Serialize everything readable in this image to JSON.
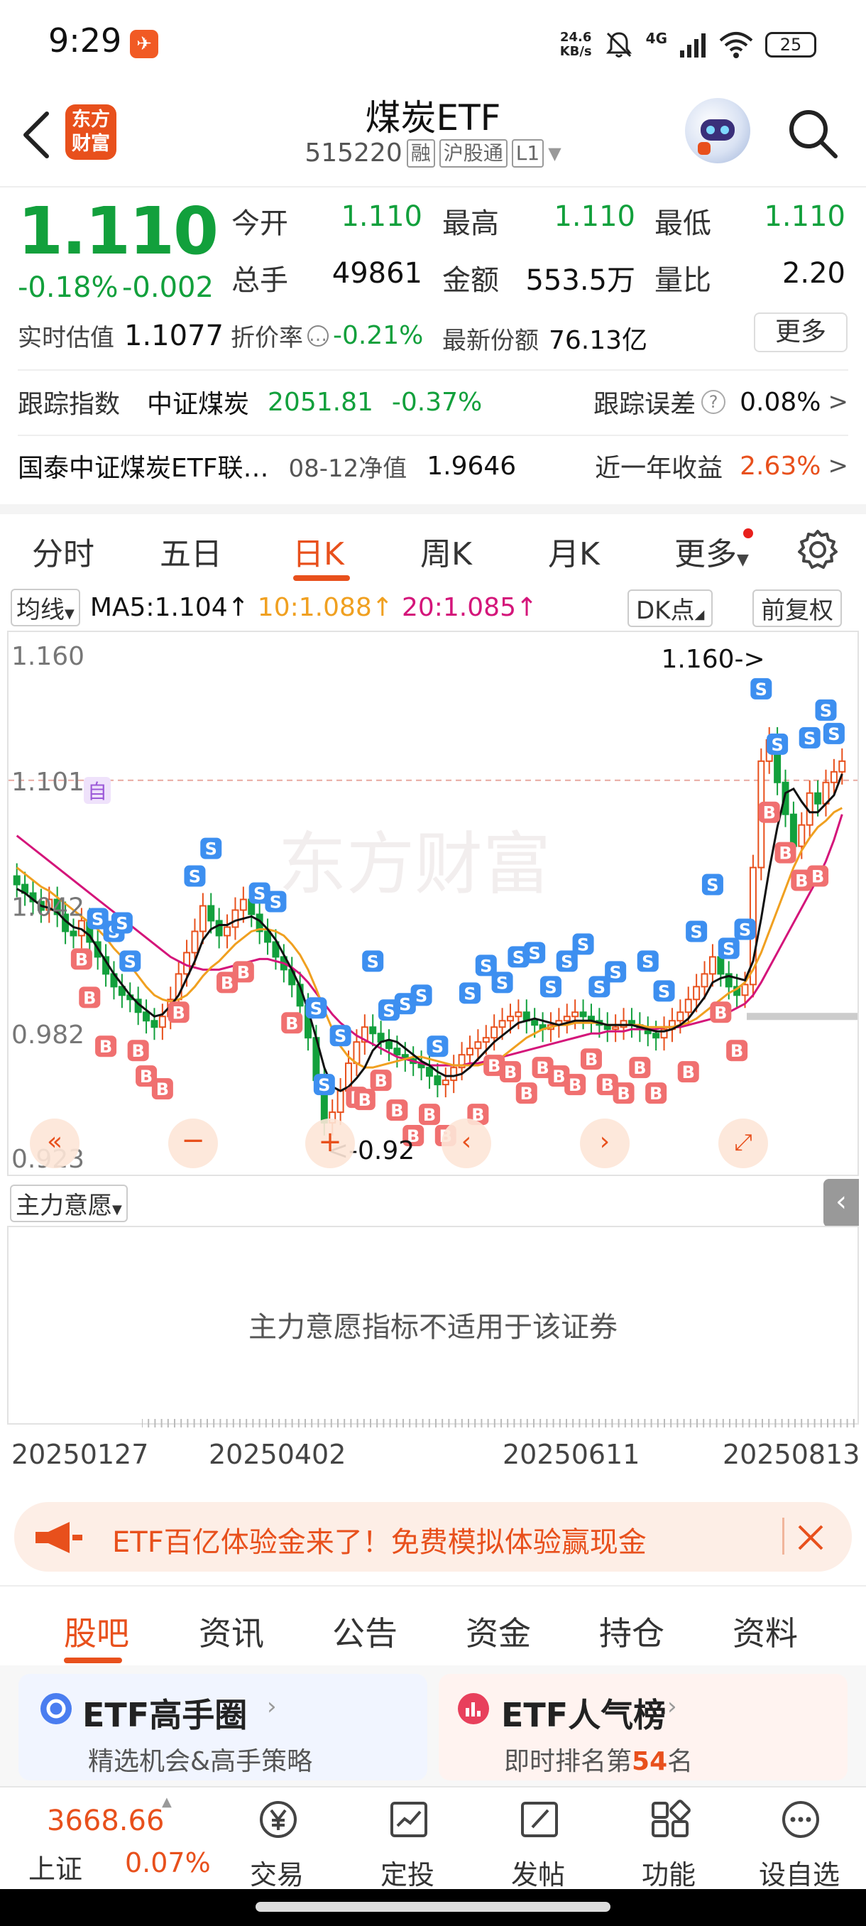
{
  "status_bar": {
    "time": "9:29",
    "net_speed_value": "24.6",
    "net_speed_unit": "KB/s",
    "network": "4G",
    "battery": "25"
  },
  "header": {
    "logo_line1": "东方",
    "logo_line2": "财富",
    "title": "煤炭ETF",
    "code": "515220",
    "tags": [
      "融",
      "沪股通",
      "L1"
    ]
  },
  "quote": {
    "price": "1.110",
    "change_pct": "-0.18%",
    "change_abs": "-0.002",
    "fields": [
      {
        "label": "今开",
        "value": "1.110",
        "green": true
      },
      {
        "label": "最高",
        "value": "1.110",
        "green": true
      },
      {
        "label": "最低",
        "value": "1.110",
        "green": true
      },
      {
        "label": "总手",
        "value": "49861",
        "green": false
      },
      {
        "label": "金额",
        "value": "553.5万",
        "green": false
      },
      {
        "label": "量比",
        "value": "2.20",
        "green": false
      }
    ],
    "rt_label": "实时估值",
    "rt_value": "1.1077",
    "discount_label": "折价率",
    "discount_value": "-0.21%",
    "shares_label": "最新份额",
    "shares_value": "76.13亿",
    "more_label": "更多",
    "track_label": "跟踪指数",
    "track_index": "中证煤炭",
    "track_value": "2051.81",
    "track_pct": "-0.37%",
    "track_err_label": "跟踪误差",
    "track_err_value": "0.08%",
    "fund_name": "国泰中证煤炭ETF联…",
    "nav_label": "08-12净值",
    "nav_value": "1.9646",
    "yearly_label": "近一年收益",
    "yearly_value": "2.63%"
  },
  "kline_tabs": [
    "分时",
    "五日",
    "日K",
    "周K",
    "月K",
    "更多"
  ],
  "kline_active": "日K",
  "ma_row": {
    "type_select": "均线",
    "ma5": "MA5:1.104",
    "ma10": "10:1.088",
    "ma20": "20:1.085",
    "dk_button": "DK点",
    "adjust_button": "前复权"
  },
  "chart_data": {
    "type": "candlestick",
    "y_ticks": [
      "1.160",
      "1.101",
      "1.042",
      "0.982",
      "0.923"
    ],
    "ylim": [
      0.923,
      1.16
    ],
    "x_ticks": [
      "20250127",
      "20250402",
      "20250611",
      "20250813"
    ],
    "annotation_high": "1.160->",
    "annotation_low": "<-0.92",
    "current_price_line": 1.101,
    "marker_self": "自",
    "close": [
      1.052,
      1.048,
      1.044,
      1.04,
      1.045,
      1.038,
      1.03,
      1.028,
      1.035,
      1.025,
      1.018,
      1.01,
      1.004,
      1.0,
      0.998,
      0.992,
      0.988,
      0.985,
      0.99,
      0.998,
      1.01,
      1.02,
      1.03,
      1.042,
      1.035,
      1.028,
      1.032,
      1.04,
      1.045,
      1.038,
      1.03,
      1.025,
      1.018,
      1.012,
      1.005,
      0.995,
      0.98,
      0.96,
      0.94,
      0.945,
      0.955,
      0.968,
      0.978,
      0.985,
      0.982,
      0.978,
      0.975,
      0.972,
      0.97,
      0.968,
      0.966,
      0.962,
      0.958,
      0.96,
      0.966,
      0.972,
      0.975,
      0.978,
      0.98,
      0.985,
      0.988,
      0.99,
      0.992,
      0.988,
      0.986,
      0.984,
      0.986,
      0.988,
      0.99,
      0.992,
      0.99,
      0.988,
      0.986,
      0.984,
      0.985,
      0.988,
      0.986,
      0.984,
      0.982,
      0.98,
      0.984,
      0.988,
      0.992,
      0.998,
      1.004,
      1.01,
      1.018,
      1.01,
      1.004,
      1.0,
      1.005,
      1.06,
      1.11,
      1.12,
      1.1,
      1.085,
      1.07,
      1.08,
      1.095,
      1.09,
      1.1,
      1.105,
      1.11
    ],
    "ma5": [
      1.05,
      1.048,
      1.045,
      1.042,
      1.041,
      1.039,
      1.035,
      1.032,
      1.031,
      1.028,
      1.022,
      1.016,
      1.01,
      1.005,
      1.0,
      0.996,
      0.993,
      0.99,
      0.991,
      0.995,
      1.0,
      1.008,
      1.016,
      1.026,
      1.031,
      1.033,
      1.033,
      1.035,
      1.036,
      1.037,
      1.035,
      1.031,
      1.026,
      1.019,
      1.012,
      1.004,
      0.993,
      0.98,
      0.966,
      0.957,
      0.955,
      0.957,
      0.961,
      0.966,
      0.974,
      0.978,
      0.979,
      0.978,
      0.975,
      0.972,
      0.969,
      0.967,
      0.964,
      0.962,
      0.962,
      0.963,
      0.966,
      0.97,
      0.974,
      0.978,
      0.981,
      0.984,
      0.987,
      0.988,
      0.989,
      0.988,
      0.987,
      0.986,
      0.987,
      0.988,
      0.988,
      0.988,
      0.987,
      0.986,
      0.986,
      0.986,
      0.986,
      0.985,
      0.984,
      0.983,
      0.983,
      0.984,
      0.986,
      0.989,
      0.994,
      0.999,
      1.006,
      1.008,
      1.009,
      1.008,
      1.007,
      1.016,
      1.036,
      1.059,
      1.079,
      1.095,
      1.097,
      1.091,
      1.086,
      1.086,
      1.09,
      1.094,
      1.104
    ],
    "ma10": [
      1.06,
      1.057,
      1.054,
      1.051,
      1.049,
      1.046,
      1.043,
      1.04,
      1.037,
      1.034,
      1.031,
      1.027,
      1.022,
      1.018,
      1.014,
      1.009,
      1.004,
      1.0,
      0.998,
      0.997,
      0.998,
      1.0,
      1.004,
      1.009,
      1.013,
      1.016,
      1.02,
      1.024,
      1.027,
      1.03,
      1.031,
      1.031,
      1.03,
      1.028,
      1.024,
      1.019,
      1.012,
      1.003,
      0.993,
      0.984,
      0.976,
      0.971,
      0.968,
      0.966,
      0.966,
      0.967,
      0.968,
      0.969,
      0.97,
      0.971,
      0.971,
      0.97,
      0.969,
      0.968,
      0.967,
      0.967,
      0.967,
      0.967,
      0.968,
      0.969,
      0.971,
      0.974,
      0.977,
      0.98,
      0.982,
      0.984,
      0.985,
      0.986,
      0.986,
      0.987,
      0.987,
      0.987,
      0.987,
      0.986,
      0.986,
      0.986,
      0.986,
      0.986,
      0.985,
      0.985,
      0.985,
      0.985,
      0.986,
      0.987,
      0.989,
      0.992,
      0.995,
      0.998,
      1.001,
      1.003,
      1.006,
      1.012,
      1.02,
      1.03,
      1.04,
      1.05,
      1.06,
      1.068,
      1.074,
      1.079,
      1.082,
      1.086,
      1.088
    ],
    "ma20": [
      1.075,
      1.072,
      1.069,
      1.066,
      1.063,
      1.06,
      1.057,
      1.054,
      1.051,
      1.048,
      1.045,
      1.042,
      1.039,
      1.036,
      1.033,
      1.03,
      1.027,
      1.024,
      1.021,
      1.018,
      1.016,
      1.014,
      1.013,
      1.012,
      1.012,
      1.012,
      1.013,
      1.014,
      1.015,
      1.016,
      1.017,
      1.017,
      1.016,
      1.015,
      1.013,
      1.01,
      1.006,
      1.001,
      0.996,
      0.991,
      0.987,
      0.984,
      0.981,
      0.979,
      0.977,
      0.975,
      0.973,
      0.971,
      0.97,
      0.969,
      0.968,
      0.967,
      0.967,
      0.967,
      0.967,
      0.967,
      0.968,
      0.968,
      0.969,
      0.97,
      0.971,
      0.972,
      0.973,
      0.974,
      0.975,
      0.976,
      0.977,
      0.978,
      0.979,
      0.98,
      0.981,
      0.982,
      0.982,
      0.983,
      0.983,
      0.983,
      0.984,
      0.984,
      0.984,
      0.984,
      0.985,
      0.985,
      0.985,
      0.986,
      0.987,
      0.988,
      0.989,
      0.99,
      0.992,
      0.994,
      0.996,
      1.0,
      1.006,
      1.013,
      1.02,
      1.027,
      1.034,
      1.041,
      1.048,
      1.055,
      1.063,
      1.073,
      1.085
    ]
  },
  "indicator": {
    "select": "主力意愿",
    "message": "主力意愿指标不适用于该证券"
  },
  "promo": {
    "text": "ETF百亿体验金来了！免费模拟体验赢现金"
  },
  "section_tabs": [
    "股吧",
    "资讯",
    "公告",
    "资金",
    "持仓",
    "资料"
  ],
  "section_active": "股吧",
  "cards": [
    {
      "title": "ETF高手圈",
      "sub": "精选机会&高手策略"
    },
    {
      "title": "ETF人气榜",
      "sub_pre": "即时排名第",
      "sub_num": "54",
      "sub_post": "名"
    }
  ],
  "bottom_nav": {
    "index_value": "3668.66",
    "index_name": "上证",
    "index_pct": "0.07%",
    "items": [
      "交易",
      "定投",
      "发帖",
      "功能",
      "设自选"
    ]
  },
  "colors": {
    "accent": "#e8501c",
    "down_green": "#12a03c",
    "up_red": "#e8501c",
    "ma5": "#111111",
    "ma10": "#f0a020",
    "ma20": "#d4157a"
  }
}
